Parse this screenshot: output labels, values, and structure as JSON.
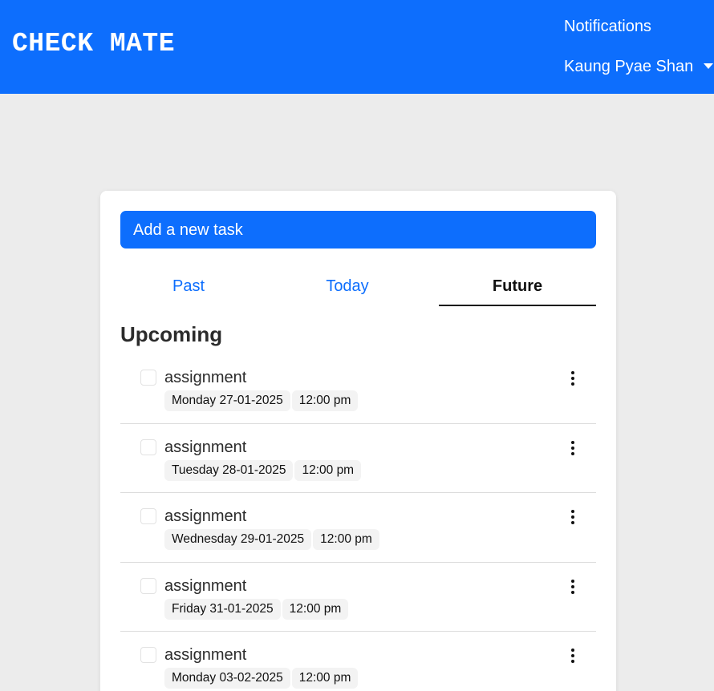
{
  "navbar": {
    "brand": "CHECK MATE",
    "notifications_label": "Notifications",
    "user_name": "Kaung Pyae Shan",
    "accent_color": "#0d6efd"
  },
  "main": {
    "add_task_label": "Add a new task",
    "tabs": [
      {
        "label": "Past",
        "active": false
      },
      {
        "label": "Today",
        "active": false
      },
      {
        "label": "Future",
        "active": true
      }
    ],
    "section_title": "Upcoming",
    "tasks": [
      {
        "title": "assignment",
        "date": "Monday 27-01-2025",
        "time": "12:00 pm",
        "checked": false
      },
      {
        "title": "assignment",
        "date": "Tuesday 28-01-2025",
        "time": "12:00 pm",
        "checked": false
      },
      {
        "title": "assignment",
        "date": "Wednesday 29-01-2025",
        "time": "12:00 pm",
        "checked": false
      },
      {
        "title": "assignment",
        "date": "Friday 31-01-2025",
        "time": "12:00 pm",
        "checked": false
      },
      {
        "title": "assignment",
        "date": "Monday 03-02-2025",
        "time": "12:00 pm",
        "checked": false
      }
    ]
  }
}
